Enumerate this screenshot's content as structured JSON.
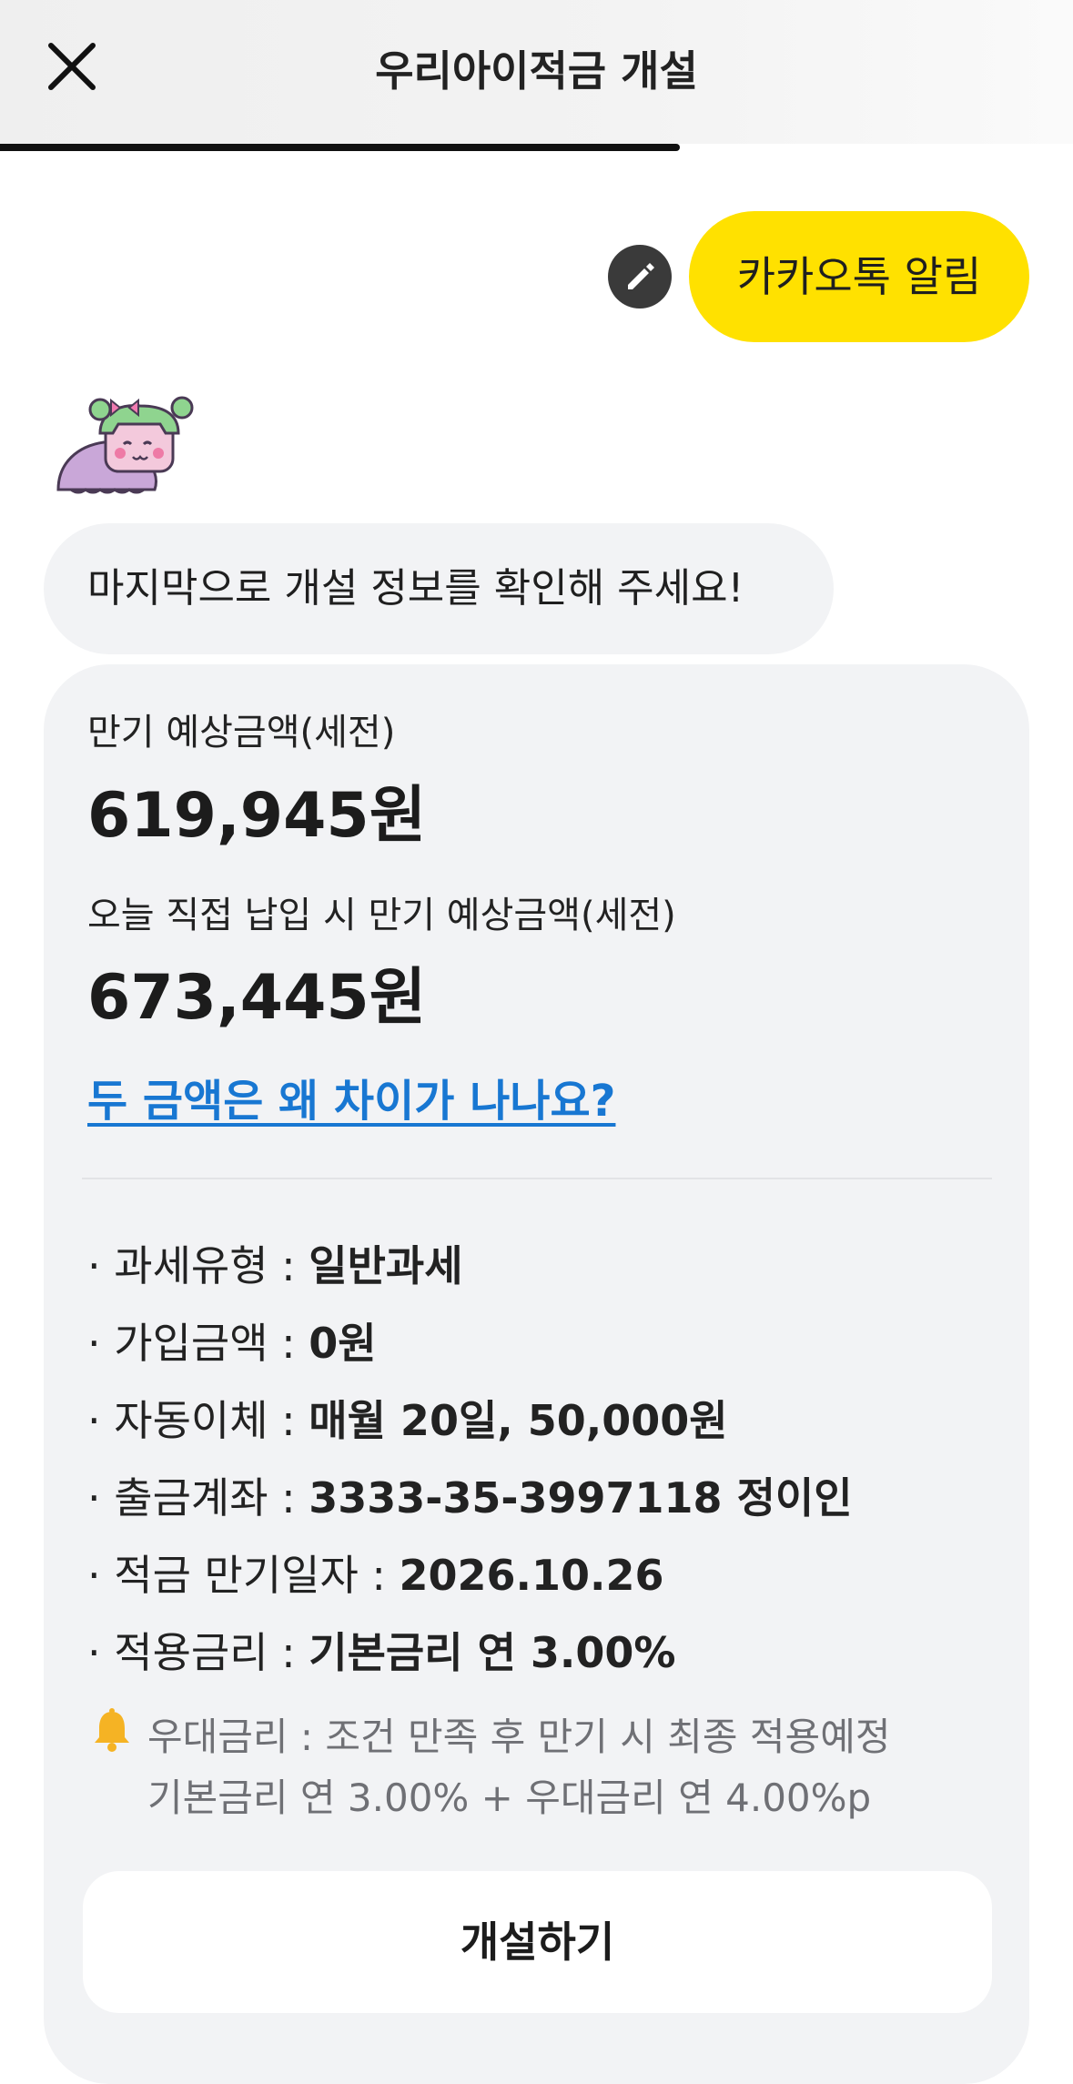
{
  "header": {
    "title": "우리아이적금 개설",
    "progress": 0.634
  },
  "chat": {
    "user_reply": "카카오톡 알림",
    "bot_message": "마지막으로 개설 정보를 확인해 주세요!"
  },
  "summary": {
    "maturity_label": "만기 예상금액(세전)",
    "maturity_amount": "619,945원",
    "today_label": "오늘 직접 납입 시 만기 예상금액(세전)",
    "today_amount": "673,445원",
    "diff_link": "두 금액은 왜 차이가 나나요?"
  },
  "details": [
    {
      "label": "· 과세유형 : ",
      "value": "일반과세"
    },
    {
      "label": "· 가입금액 : ",
      "value": "0원"
    },
    {
      "label": "· 자동이체 : ",
      "value": "매월 20일, 50,000원"
    },
    {
      "label": "· 출금계좌 : ",
      "value": "3333-35-3997118 정이인"
    },
    {
      "label": "· 적금 만기일자 : ",
      "value": "2026.10.26"
    },
    {
      "label": "· 적용금리 : ",
      "value": "기본금리 연 3.00%"
    }
  ],
  "preferential": {
    "line1": "우대금리 : 조건 만족 후 만기 시 최종 적용예정",
    "line2": "기본금리 연 3.00% + 우대금리 연 4.00%p"
  },
  "open_button": "개설하기",
  "colors": {
    "kakao_yellow": "#FFE100",
    "link_blue": "#1877d2",
    "card_gray": "#f2f3f5"
  }
}
